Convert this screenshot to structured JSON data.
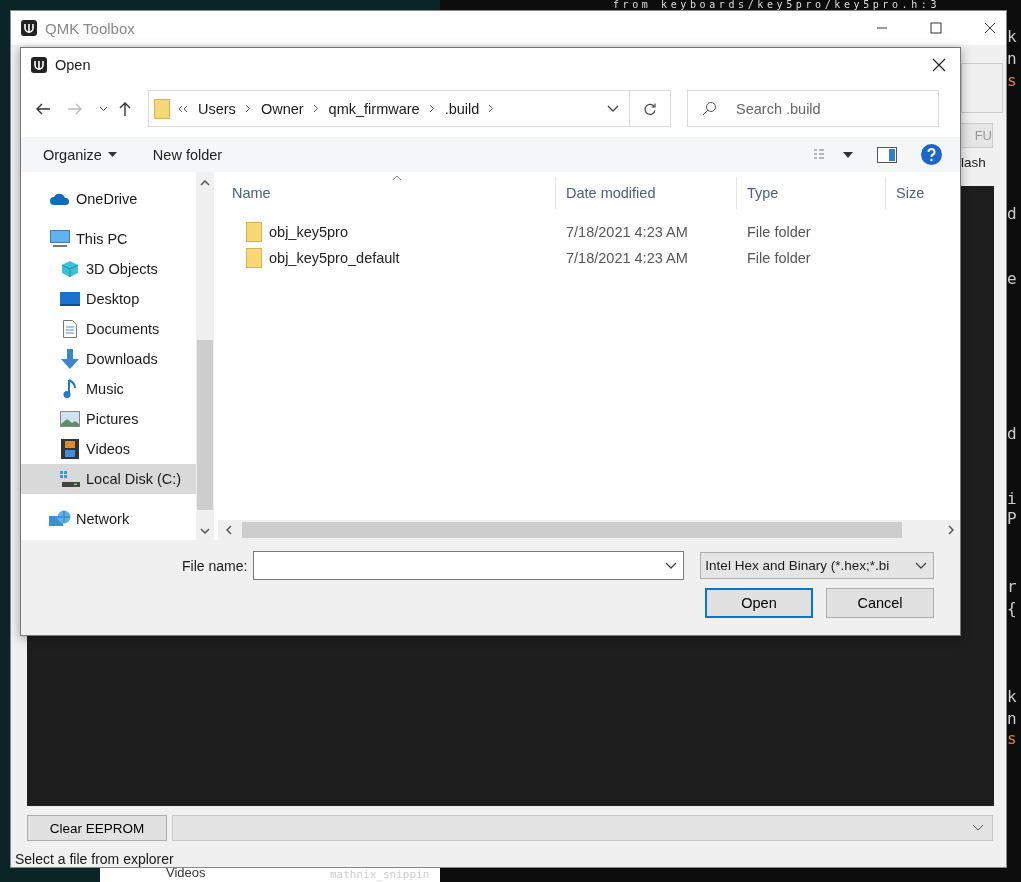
{
  "background_editor": {
    "top_line": "from keyboards/key5pro/key5pro.h:3",
    "edge_fragments": [
      {
        "text": "k",
        "kind": "plain"
      },
      {
        "text": "n",
        "kind": "plain"
      },
      {
        "text": "s",
        "kind": "string"
      },
      {
        "text": "d",
        "kind": "plain"
      },
      {
        "text": "e",
        "kind": "plain"
      },
      {
        "text": "d",
        "kind": "plain"
      },
      {
        "text": "i",
        "kind": "plain"
      },
      {
        "text": "P",
        "kind": "plain"
      },
      {
        "text": "r",
        "kind": "plain"
      },
      {
        "text": "{",
        "kind": "plain"
      },
      {
        "text": "k",
        "kind": "plain"
      },
      {
        "text": "n",
        "kind": "plain"
      },
      {
        "text": "s",
        "kind": "string"
      }
    ],
    "bottom_fragments": [
      "Videos",
      "mathnix_snippin"
    ]
  },
  "window": {
    "title": "QMK Toolbox"
  },
  "toolbox": {
    "partial_button": "FU",
    "partial_label": "lash",
    "clear_button": "Clear EEPROM",
    "status_bar": "Select a file from explorer"
  },
  "dialog": {
    "title": "Open",
    "breadcrumb": [
      "Users",
      "Owner",
      "qmk_firmware",
      ".build"
    ],
    "search": {
      "placeholder": "Search .build"
    },
    "toolbar": {
      "organize": "Organize",
      "new_folder": "New folder"
    },
    "nav": [
      {
        "label": "OneDrive",
        "kind": "cloud",
        "selected": false
      },
      {
        "label": "This PC",
        "kind": "pc",
        "selected": false,
        "children": [
          {
            "label": "3D Objects",
            "kind": "cube",
            "selected": false
          },
          {
            "label": "Desktop",
            "kind": "desktop",
            "selected": false
          },
          {
            "label": "Documents",
            "kind": "document",
            "selected": false
          },
          {
            "label": "Downloads",
            "kind": "download",
            "selected": false
          },
          {
            "label": "Music",
            "kind": "music",
            "selected": false
          },
          {
            "label": "Pictures",
            "kind": "pictures",
            "selected": false
          },
          {
            "label": "Videos",
            "kind": "videos",
            "selected": false
          },
          {
            "label": "Local Disk (C:)",
            "kind": "disk",
            "selected": true
          }
        ]
      },
      {
        "label": "Network",
        "kind": "network",
        "selected": false
      }
    ],
    "columns": [
      "Name",
      "Date modified",
      "Type",
      "Size"
    ],
    "rows": [
      {
        "name": "obj_key5pro",
        "date": "7/18/2021 4:23 AM",
        "type": "File folder",
        "selected": false
      },
      {
        "name": "obj_key5pro_default",
        "date": "7/18/2021 4:23 AM",
        "type": "File folder",
        "selected": false
      }
    ],
    "file_name": {
      "label": "File name:"
    },
    "filter": "Intel Hex and Binary (*.hex;*.bi",
    "buttons": [
      {
        "label": "Open",
        "default": true
      },
      {
        "label": "Cancel",
        "default": false
      }
    ]
  }
}
